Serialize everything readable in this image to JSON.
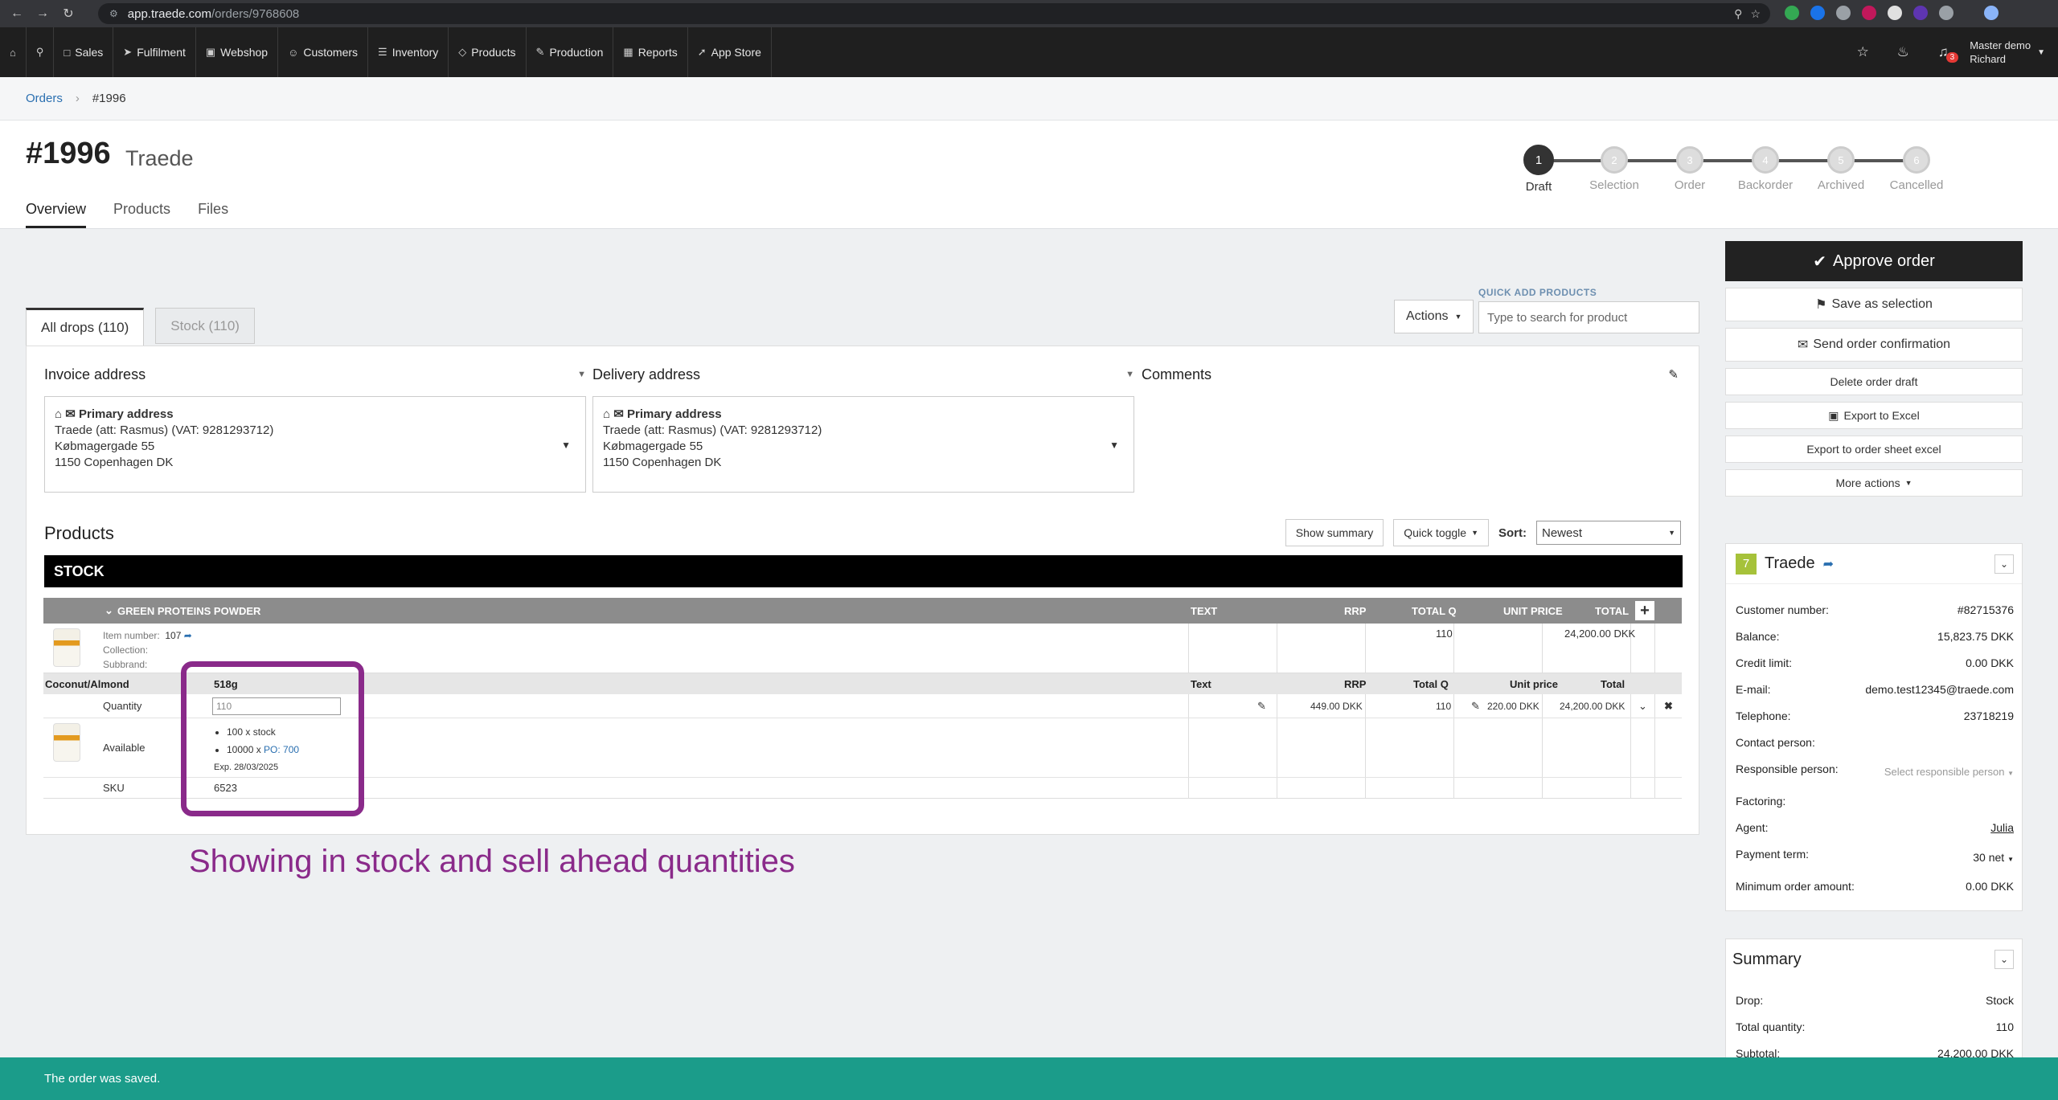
{
  "browser": {
    "url_host": "app.traede.com",
    "url_path": "/orders/9768608"
  },
  "nav": {
    "items": [
      {
        "label": "Sales",
        "icon": "file-icon"
      },
      {
        "label": "Fulfilment",
        "icon": "send-icon"
      },
      {
        "label": "Webshop",
        "icon": "cart-icon"
      },
      {
        "label": "Customers",
        "icon": "users-icon"
      },
      {
        "label": "Inventory",
        "icon": "layers-icon"
      },
      {
        "label": "Products",
        "icon": "tag-icon"
      },
      {
        "label": "Production",
        "icon": "pencil-icon"
      },
      {
        "label": "Reports",
        "icon": "chart-icon"
      },
      {
        "label": "App Store",
        "icon": "rocket-icon"
      }
    ],
    "notifications_count": "3",
    "user_line1": "Master demo",
    "user_line2": "Richard"
  },
  "breadcrumb": {
    "root": "Orders",
    "current": "#1996"
  },
  "order": {
    "number": "#1996",
    "company": "Traede",
    "tabs": [
      "Overview",
      "Products",
      "Files"
    ]
  },
  "stepper": [
    {
      "n": "1",
      "label": "Draft"
    },
    {
      "n": "2",
      "label": "Selection"
    },
    {
      "n": "3",
      "label": "Order"
    },
    {
      "n": "4",
      "label": "Backorder"
    },
    {
      "n": "5",
      "label": "Archived"
    },
    {
      "n": "6",
      "label": "Cancelled"
    }
  ],
  "drops": {
    "all": "All drops (110)",
    "stock": "Stock (110)"
  },
  "actions_label": "Actions",
  "quick_add": {
    "label": "QUICK ADD PRODUCTS",
    "placeholder": "Type to search for product"
  },
  "invoice": {
    "title": "Invoice address",
    "primary": "Primary address",
    "line1": "Traede (att: Rasmus) (VAT: 9281293712)",
    "line2": "Købmagergade 55",
    "line3": "1150 Copenhagen DK"
  },
  "delivery": {
    "title": "Delivery address",
    "primary": "Primary address",
    "line1": "Traede (att: Rasmus) (VAT: 9281293712)",
    "line2": "Købmagergade 55",
    "line3": "1150 Copenhagen DK"
  },
  "comments_title": "Comments",
  "products": {
    "title": "Products",
    "show_summary": "Show summary",
    "quick_toggle": "Quick toggle",
    "sort_label": "Sort:",
    "sort_value": "Newest",
    "stock_bar": "STOCK",
    "group": {
      "name": "GREEN PROTEINS POWDER",
      "cols": {
        "text": "TEXT",
        "rrp": "RRP",
        "total_q": "TOTAL Q",
        "unit_price": "UNIT PRICE",
        "total": "TOTAL"
      },
      "item_number_label": "Item number:",
      "item_number": "107",
      "collection_label": "Collection:",
      "subbrand_label": "Subbrand:",
      "total_q": "110",
      "total": "24,200.00 DKK"
    },
    "variant": {
      "name": "Coconut/Almond",
      "size": "518g",
      "cols": {
        "text": "Text",
        "rrp": "RRP",
        "total_q": "Total Q",
        "unit_price": "Unit price",
        "total": "Total"
      },
      "quantity_label": "Quantity",
      "quantity_value": "110",
      "rrp": "449.00 DKK",
      "total_q": "110",
      "unit_price": "220.00 DKK",
      "total": "24,200.00 DKK",
      "available_label": "Available",
      "available_stock": "100 x stock",
      "available_po_qty": "10000 x",
      "available_po": "PO: 700",
      "available_exp": "Exp. 28/03/2025",
      "sku_label": "SKU",
      "sku": "6523"
    }
  },
  "annotation": "Showing in stock and sell ahead quantities",
  "sidebar": {
    "approve": "Approve order",
    "save_selection": "Save as selection",
    "send_confirmation": "Send order confirmation",
    "delete_draft": "Delete order draft",
    "export_excel": "Export to Excel",
    "export_sheet": "Export to order sheet excel",
    "more_actions": "More actions"
  },
  "customer": {
    "badge": "7",
    "name": "Traede",
    "fields": [
      {
        "label": "Customer number:",
        "value": "#82715376"
      },
      {
        "label": "Balance:",
        "value": "15,823.75 DKK"
      },
      {
        "label": "Credit limit:",
        "value": "0.00 DKK"
      },
      {
        "label": "E-mail:",
        "value": "demo.test12345@traede.com"
      },
      {
        "label": "Telephone:",
        "value": "23718219"
      },
      {
        "label": "Contact person:",
        "value": ""
      },
      {
        "label": "Responsible person:",
        "value": "Select responsible person"
      },
      {
        "label": "Factoring:",
        "value": ""
      },
      {
        "label": "Agent:",
        "value": "Julia"
      },
      {
        "label": "Payment term:",
        "value": "30 net"
      },
      {
        "label": "Minimum order amount:",
        "value": "0.00 DKK"
      }
    ]
  },
  "summary": {
    "title": "Summary",
    "fields": [
      {
        "label": "Drop:",
        "value": "Stock"
      },
      {
        "label": "Total quantity:",
        "value": "110"
      },
      {
        "label": "Subtotal:",
        "value": "24,200.00 DKK"
      }
    ]
  },
  "toast": "The order was saved."
}
